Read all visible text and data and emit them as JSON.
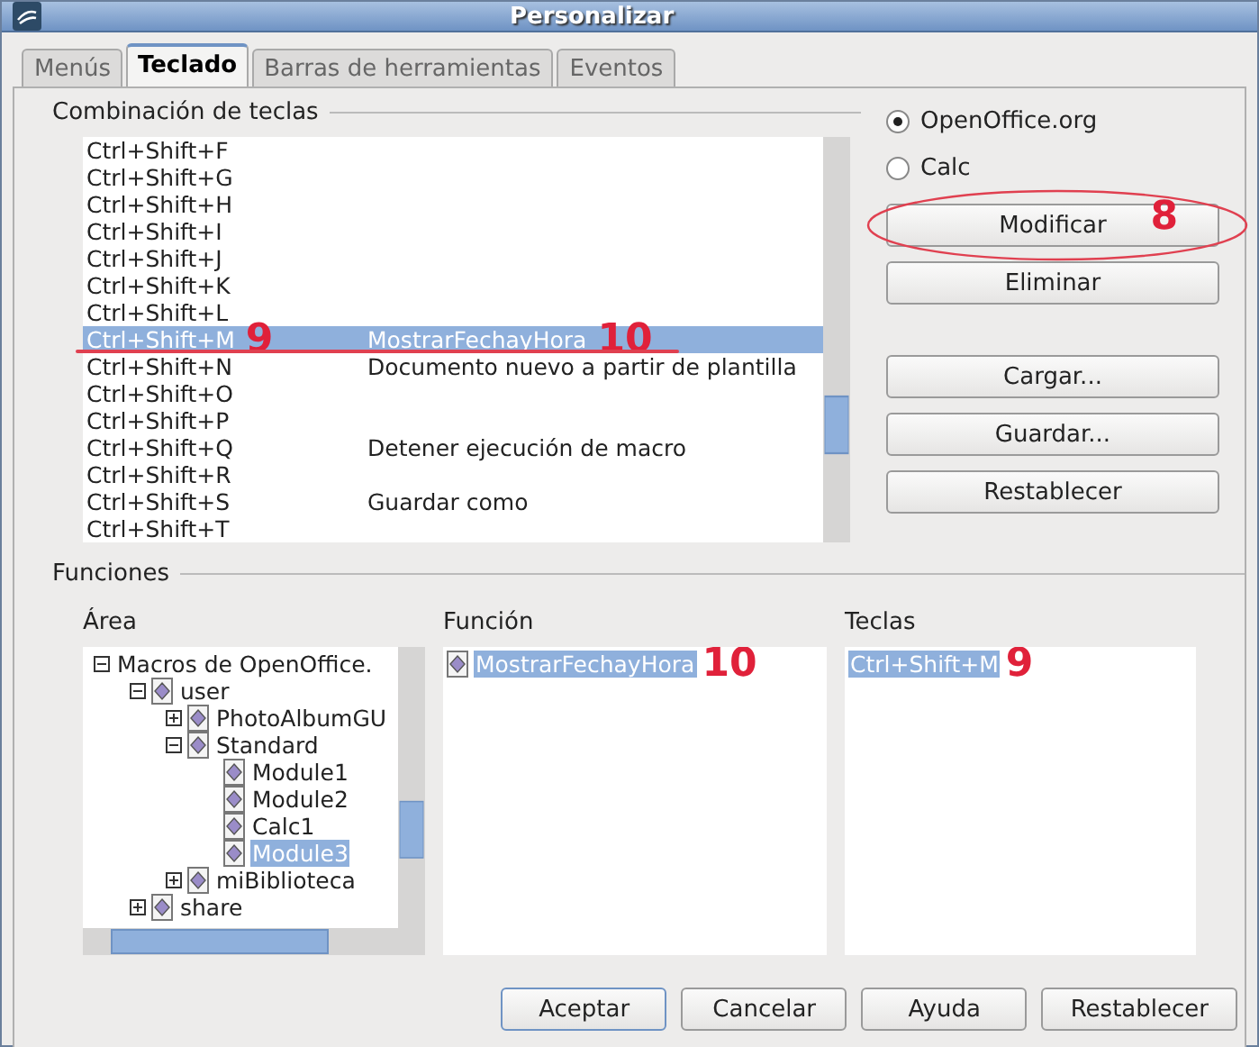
{
  "window": {
    "title": "Personalizar"
  },
  "tabs": [
    {
      "label": "Menús",
      "selected": false
    },
    {
      "label": "Teclado",
      "selected": true
    },
    {
      "label": "Barras de herramientas",
      "selected": false
    },
    {
      "label": "Eventos",
      "selected": false
    }
  ],
  "shortcuts": {
    "title": "Combinación de teclas",
    "rows": [
      {
        "key": "Ctrl+Shift+F",
        "selected": false
      },
      {
        "key": "Ctrl+Shift+G",
        "selected": false
      },
      {
        "key": "Ctrl+Shift+H",
        "selected": false
      },
      {
        "key": "Ctrl+Shift+I",
        "selected": false
      },
      {
        "key": "Ctrl+Shift+J",
        "selected": false
      },
      {
        "key": "Ctrl+Shift+K",
        "selected": false
      },
      {
        "key": "Ctrl+Shift+L",
        "selected": false
      },
      {
        "key": "Ctrl+Shift+M",
        "action": "MostrarFechayHora",
        "selected": true,
        "key_note": "9",
        "action_note": "10"
      },
      {
        "key": "Ctrl+Shift+N",
        "action": "Documento nuevo a partir de plantilla",
        "selected": false
      },
      {
        "key": "Ctrl+Shift+O",
        "selected": false
      },
      {
        "key": "Ctrl+Shift+P",
        "selected": false
      },
      {
        "key": "Ctrl+Shift+Q",
        "action": "Detener ejecución de macro",
        "selected": false
      },
      {
        "key": "Ctrl+Shift+R",
        "selected": false
      },
      {
        "key": "Ctrl+Shift+S",
        "action": "Guardar como",
        "selected": false
      },
      {
        "key": "Ctrl+Shift+T",
        "selected": false
      }
    ]
  },
  "scope": [
    {
      "label": "OpenOffice.org",
      "selected": true
    },
    {
      "label": "Calc",
      "selected": false
    }
  ],
  "side_buttons": [
    {
      "label": "Modificar",
      "note": "8",
      "circled": true
    },
    {
      "label": "Eliminar",
      "circled": false
    },
    {
      "label": "Cargar...",
      "circled": false
    },
    {
      "label": "Guardar...",
      "circled": false
    },
    {
      "label": "Restablecer",
      "circled": false
    }
  ],
  "functions": {
    "title": "Funciones",
    "area_label": "Área",
    "function_label": "Función",
    "keys_label": "Teclas",
    "tree": [
      {
        "label": "Macros de OpenOffice.",
        "icon": false,
        "expanded": true,
        "selected": false,
        "children": [
          {
            "label": "user",
            "icon": true,
            "expanded": true,
            "selected": false,
            "children": [
              {
                "label": "PhotoAlbumGU",
                "icon": true,
                "expanded": false,
                "selected": false
              },
              {
                "label": "Standard",
                "icon": true,
                "expanded": true,
                "selected": false,
                "children": [
                  {
                    "label": "Module1",
                    "icon": true,
                    "selected": false
                  },
                  {
                    "label": "Module2",
                    "icon": true,
                    "selected": false
                  },
                  {
                    "label": "Calc1",
                    "icon": true,
                    "selected": false
                  },
                  {
                    "label": "Module3",
                    "icon": true,
                    "selected": true
                  }
                ]
              },
              {
                "label": "miBiblioteca",
                "icon": true,
                "expanded": false,
                "selected": false
              }
            ]
          },
          {
            "label": "share",
            "icon": true,
            "expanded": false,
            "selected": false
          }
        ]
      }
    ],
    "function_items": [
      {
        "label": "MostrarFechayHora",
        "selected": true,
        "note": "10"
      }
    ],
    "key_items": [
      {
        "label": "Ctrl+Shift+M",
        "selected": true,
        "note": "9"
      }
    ]
  },
  "buttons": [
    {
      "label": "Aceptar",
      "default": true
    },
    {
      "label": "Cancelar",
      "default": false
    },
    {
      "label": "Ayuda",
      "default": false
    },
    {
      "label": "Restablecer",
      "default": false
    }
  ]
}
